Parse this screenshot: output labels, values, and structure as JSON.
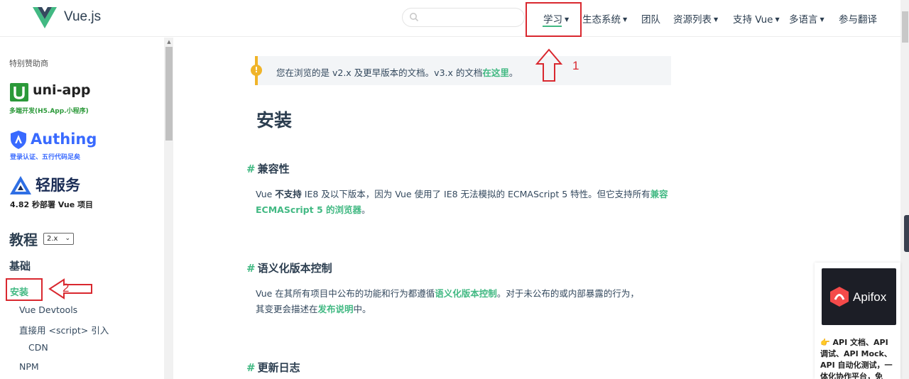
{
  "header": {
    "brand": "Vue.js",
    "search": {
      "placeholder": ""
    },
    "nav": [
      {
        "label": "学习",
        "caret": "▼"
      },
      {
        "label": "生态系统",
        "caret": "▼"
      },
      {
        "label": "团队",
        "caret": ""
      },
      {
        "label": "资源列表",
        "caret": "▼"
      },
      {
        "label": "支持 Vue",
        "caret": "▼"
      },
      {
        "label": "多语言",
        "caret": "▼"
      },
      {
        "label": "参与翻译",
        "caret": ""
      }
    ]
  },
  "sidebar": {
    "sponsor_label": "特别赞助商",
    "sponsors": [
      {
        "name": "uni-app",
        "tagline": "多端开发(H5.App.小程序)",
        "logo_letter": "u"
      },
      {
        "name": "Authing",
        "tagline": "登录认证、五行代码足矣"
      },
      {
        "name": "轻服务",
        "tagline": "4.82 秒部署 Vue 项目"
      }
    ],
    "tutorial_title": "教程",
    "version": "2.x",
    "section": "基础",
    "items": [
      {
        "label": "安装"
      },
      {
        "label": "Vue Devtools"
      },
      {
        "label": "直接用 <script> 引入"
      },
      {
        "label": "CDN"
      },
      {
        "label": "NPM"
      }
    ]
  },
  "notice": {
    "icon": "!",
    "text": "您在浏览的是 v2.x 及更早版本的文档。v3.x 的文档",
    "link": "在这里",
    "suffix": "。"
  },
  "content": {
    "title": "安装",
    "hash": "#",
    "sections": [
      {
        "heading": "兼容性",
        "line1_a": "Vue ",
        "line1_b": "不支持",
        "line1_c": " IE8 及以下版本，因为 Vue 使用了 IE8 无法模拟的 ECMAScript 5 特性。但它支持所有",
        "line1_link": "兼容",
        "line2_link": "ECMAScript 5 的浏览器",
        "line2_suffix": "。"
      },
      {
        "heading": "语义化版本控制",
        "line1_a": "Vue 在其所有项目中公布的功能和行为都遵循",
        "line1_link": "语义化版本控制",
        "line1_c": "。对于未公布的或内部暴露的行为，",
        "line2_a": "其变更会描述在",
        "line2_link": "发布说明",
        "line2_suffix": "中。"
      },
      {
        "heading": "更新日志"
      }
    ]
  },
  "annotations": {
    "label_1": "1",
    "label_2": "2"
  },
  "ad": {
    "name": "Apifox",
    "text": "👉 API 文档、API 调试、API Mock、API 自动化测试，一体化协作平台，免"
  },
  "colors": {
    "accent": "#42b983",
    "annotation": "#d9282f",
    "notice_bar": "#f0b429"
  }
}
